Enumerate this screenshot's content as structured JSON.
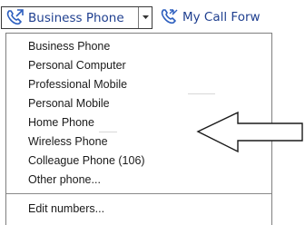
{
  "toolbar": {
    "phone_select": {
      "label": "Business Phone",
      "icon": "phone-handset-icon",
      "dropdown_icon": "chevron-down-icon"
    },
    "call_forward": {
      "label": "My Call Forw",
      "icon": "call-forward-icon"
    }
  },
  "menu": {
    "items": [
      {
        "label": "Business Phone"
      },
      {
        "label": "Personal Computer"
      },
      {
        "label": "Professional Mobile"
      },
      {
        "label": "Personal Mobile"
      },
      {
        "label": "Home Phone"
      },
      {
        "label": "Wireless Phone"
      },
      {
        "label": "Colleague Phone (106)"
      },
      {
        "label": "Other phone..."
      }
    ],
    "edit": {
      "label": "Edit numbers..."
    }
  },
  "annotation": {
    "icon": "left-arrow-icon"
  },
  "colors": {
    "toolbar_text": "#1f3f8f",
    "menu_text": "#1a1a1a",
    "border": "#7f7f7f"
  }
}
